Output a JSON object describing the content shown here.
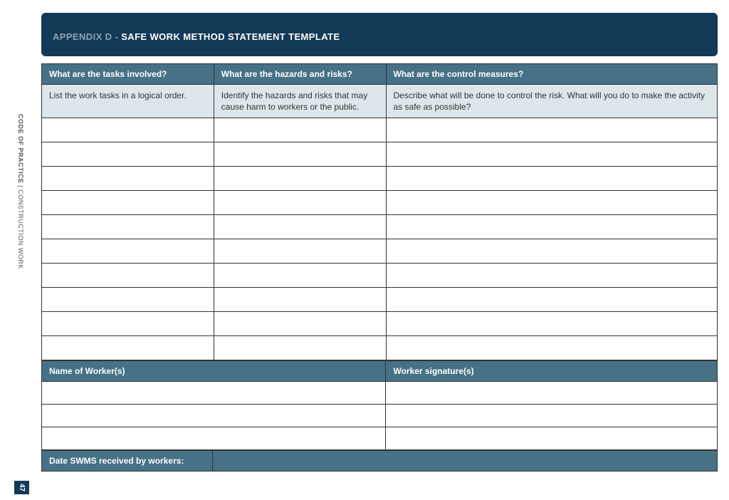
{
  "sidebar": {
    "bold": "CODE OF PRACTICE",
    "separator": " | ",
    "light": "CONSTRUCTION WORK"
  },
  "page_number": "47",
  "header": {
    "appendix": "APPENDIX D - ",
    "title": "SAFE WORK METHOD STATEMENT TEMPLATE"
  },
  "main_table": {
    "headers": [
      "What are the tasks involved?",
      "What are the hazards and risks?",
      "What are the control measures?"
    ],
    "subheaders": [
      "List the work tasks in a logical order.",
      "Identify the hazards and risks that may cause harm to workers or the public.",
      "Describe what will be done to control the risk. What will you do to make the activity as safe as possible?"
    ],
    "rows": [
      [
        "",
        "",
        ""
      ],
      [
        "",
        "",
        ""
      ],
      [
        "",
        "",
        ""
      ],
      [
        "",
        "",
        ""
      ],
      [
        "",
        "",
        ""
      ],
      [
        "",
        "",
        ""
      ],
      [
        "",
        "",
        ""
      ],
      [
        "",
        "",
        ""
      ],
      [
        "",
        "",
        ""
      ],
      [
        "",
        "",
        ""
      ]
    ]
  },
  "worker_table": {
    "headers": [
      "Name of Worker(s)",
      "Worker signature(s)"
    ],
    "rows": [
      [
        "",
        ""
      ],
      [
        "",
        ""
      ],
      [
        "",
        ""
      ]
    ]
  },
  "date_row": {
    "label": "Date SWMS received by workers:",
    "value": ""
  }
}
